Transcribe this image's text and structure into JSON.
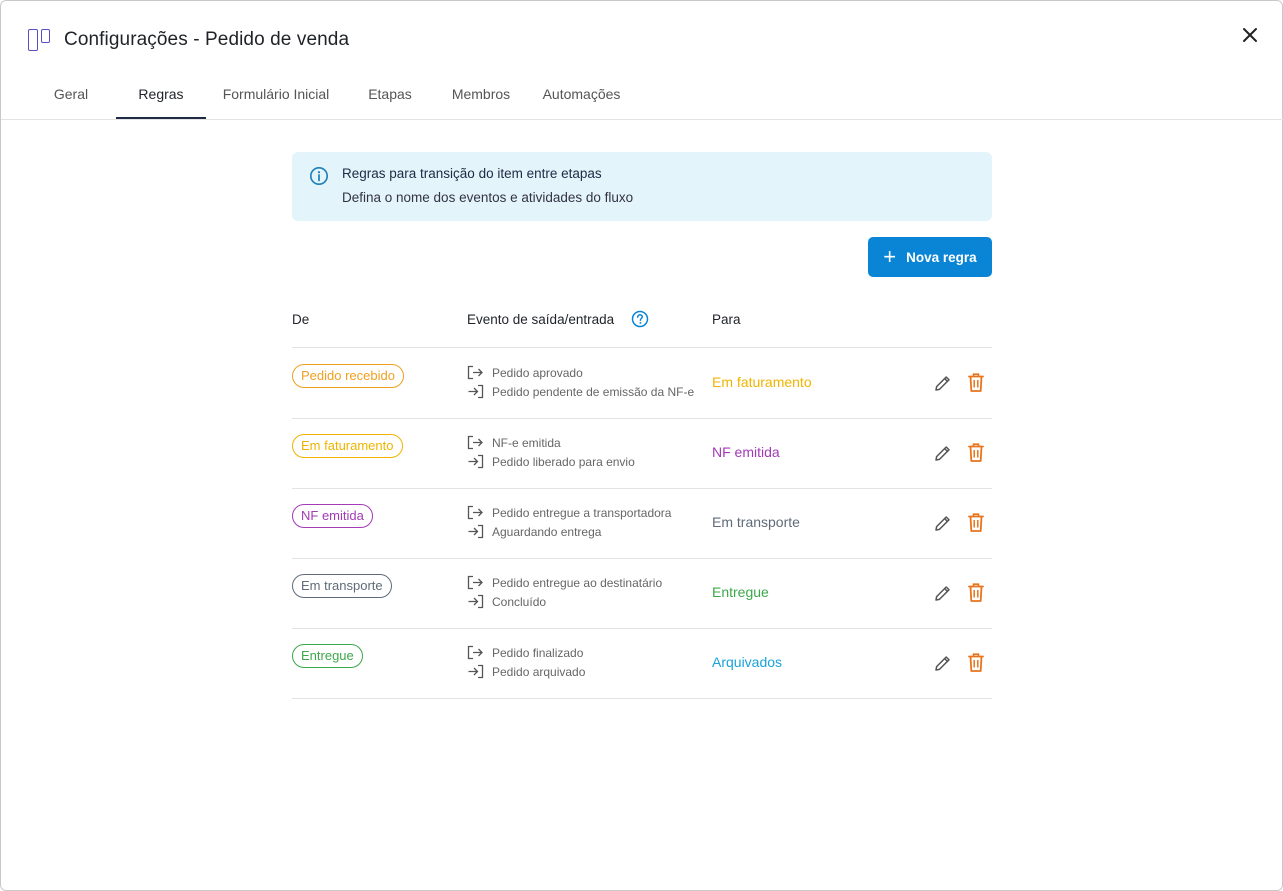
{
  "window": {
    "title": "Configurações - Pedido de venda",
    "app_icon": "board-columns-icon",
    "close_icon": "close-icon"
  },
  "tabs": [
    {
      "label": "Geral",
      "active": false
    },
    {
      "label": "Regras",
      "active": true
    },
    {
      "label": "Formulário Inicial",
      "active": false
    },
    {
      "label": "Etapas",
      "active": false
    },
    {
      "label": "Membros",
      "active": false
    },
    {
      "label": "Automações",
      "active": false
    }
  ],
  "info": {
    "title": "Regras para transição do item entre etapas",
    "text": "Defina o nome dos eventos e atividades do fluxo",
    "icon": "info-icon"
  },
  "new_rule_button": {
    "label": "Nova regra",
    "icon": "plus-icon"
  },
  "table": {
    "headers": {
      "from": "De",
      "event": "Evento de saída/entrada",
      "to": "Para"
    },
    "rows": [
      {
        "from": "Pedido recebido",
        "from_color": "#f0a020",
        "exit_event": "Pedido aprovado",
        "entry_event": "Pedido pendente de emissão da NF-e",
        "to": "Em faturamento",
        "to_color": "#f0b400"
      },
      {
        "from": "Em faturamento",
        "from_color": "#f0b400",
        "exit_event": "NF-e emitida",
        "entry_event": "Pedido liberado para envio",
        "to": "NF emitida",
        "to_color": "#a23bb5"
      },
      {
        "from": "NF emitida",
        "from_color": "#a23bb5",
        "exit_event": "Pedido entregue a transportadora",
        "entry_event": "Aguardando entrega",
        "to": "Em transporte",
        "to_color": "#5f6b7a"
      },
      {
        "from": "Em transporte",
        "from_color": "#5f6b7a",
        "exit_event": "Pedido entregue ao destinatário",
        "entry_event": "Concluído",
        "to": "Entregue",
        "to_color": "#3da84a"
      },
      {
        "from": "Entregue",
        "from_color": "#3da84a",
        "exit_event": "Pedido finalizado",
        "entry_event": "Pedido arquivado",
        "to": "Arquivados",
        "to_color": "#1aa3d9"
      }
    ]
  },
  "colors": {
    "accent": "#0a85d6",
    "delete": "#e8741c",
    "info_bg": "#e3f4fb"
  }
}
